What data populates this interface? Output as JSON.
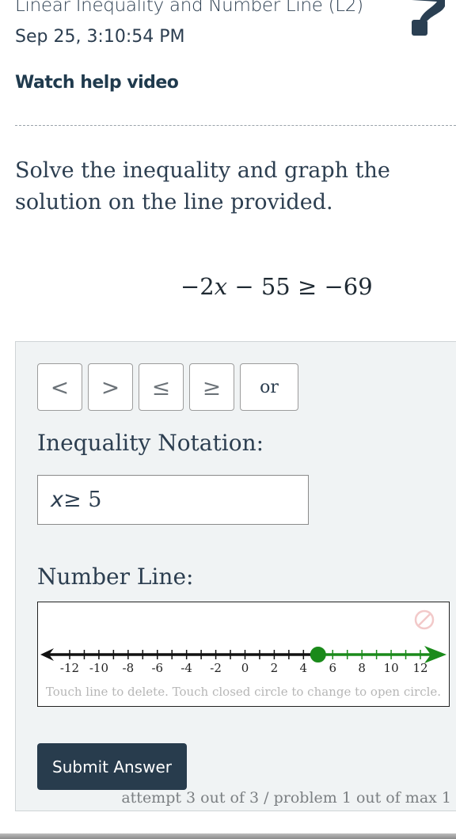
{
  "header": {
    "title": "Linear Inequality and Number Line (L2)",
    "date": "Sep 25, 3:10:54 PM",
    "help_icon": "question-mark-icon"
  },
  "help_link": "Watch help video",
  "question": {
    "prompt": "Solve the inequality and graph the solution on the line provided.",
    "equation": {
      "coef": "−2",
      "var": "x",
      "rest": " − 55 ≥ −69"
    }
  },
  "symbol_buttons": [
    {
      "label": "<",
      "name": "less-than"
    },
    {
      "label": ">",
      "name": "greater-than"
    },
    {
      "label": "≤",
      "name": "less-or-equal"
    },
    {
      "label": "≥",
      "name": "greater-or-equal"
    },
    {
      "label": "or",
      "name": "or"
    }
  ],
  "inequality_notation": {
    "label": "Inequality Notation:",
    "value_var": "x",
    "value_rest": " ≥ 5"
  },
  "number_line": {
    "label": "Number Line:",
    "range": [
      -13,
      13
    ],
    "tick_labels": [
      "-12",
      "-10",
      "-8",
      "-6",
      "-4",
      "-2",
      "0",
      "2",
      "4",
      "6",
      "8",
      "10",
      "12"
    ],
    "solution": {
      "endpoint": 5,
      "endpoint_type": "closed",
      "direction": "right"
    },
    "colors": {
      "axis": "#111111",
      "solution": "#1a8a1a",
      "delete_icon": "#f2c9c9"
    },
    "delete_icon": "no-entry-icon",
    "instructions": "Touch line to delete. Touch closed circle to change to open circle."
  },
  "submit": {
    "label": "Submit Answer"
  },
  "attempt_info": "attempt 3 out of 3 / problem 1 out of max 1"
}
